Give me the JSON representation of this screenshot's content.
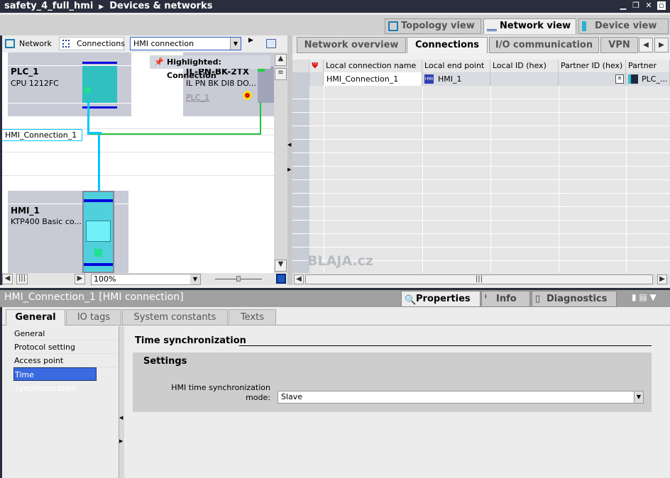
{
  "titlebar": {
    "project": "safety_4_full_hmi",
    "page": "Devices & networks",
    "window_controls": [
      "minimize",
      "restore",
      "close",
      "float"
    ]
  },
  "views": [
    {
      "label": "Topology view",
      "icon": "topology-icon"
    },
    {
      "label": "Network view",
      "icon": "network-icon",
      "active": true
    },
    {
      "label": "Device view",
      "icon": "device-icon"
    }
  ],
  "network_toolbar": {
    "network_label": "Network",
    "connections_label": "Connections",
    "connection_type": "HMI connection",
    "highlight_tooltip": "Highlighted: Connection"
  },
  "canvas": {
    "devices": [
      {
        "name": "PLC_1",
        "type": "CPU 1212FC"
      },
      {
        "name": "IL-PN-BK-2TX",
        "type": "IL PN BK DI8 DO...",
        "controller": "PLC_1"
      },
      {
        "name": "HMI_1",
        "type": "KTP400 Basic co..."
      }
    ],
    "connection_label": "HMI_Connection_1",
    "zoom": "100%",
    "colors": {
      "connection": "#00c8ff",
      "network": "#22c040",
      "rail": "#0000dd",
      "device": "#3fc8d0"
    }
  },
  "right_tabs": [
    {
      "label": "Network overview"
    },
    {
      "label": "Connections",
      "active": true
    },
    {
      "label": "I/O communication"
    },
    {
      "label": "VPN"
    }
  ],
  "table": {
    "columns": [
      "Local connection name",
      "Local end point",
      "Local ID (hex)",
      "Partner ID (hex)",
      "Partner"
    ],
    "rows": [
      {
        "name": "HMI_Connection_1",
        "local_end_point": "HMI_1",
        "local_id": "",
        "partner_id": "",
        "partner": "PLC_..."
      }
    ]
  },
  "watermark": "BLAJA.cz",
  "inspector": {
    "title": "HMI_Connection_1 [HMI connection]",
    "tabs": [
      {
        "label": "Properties",
        "active": true
      },
      {
        "label": "Info"
      },
      {
        "label": "Diagnostics"
      }
    ],
    "subtabs": [
      {
        "label": "General",
        "active": true
      },
      {
        "label": "IO tags"
      },
      {
        "label": "System constants"
      },
      {
        "label": "Texts"
      }
    ],
    "nav": [
      "General",
      "Protocol setting",
      "Access point",
      "Time synchronization"
    ],
    "section_title": "Time synchronization",
    "group_title": "Settings",
    "field_label_1": "HMI time synchronization",
    "field_label_2": "mode:",
    "field_value": "Slave"
  }
}
